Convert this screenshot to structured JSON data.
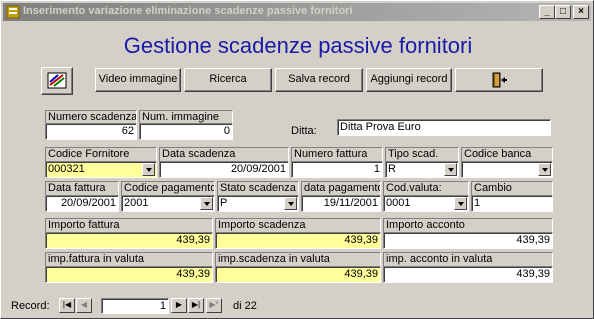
{
  "window": {
    "title": "Inserimento variazione eliminazione scadenze passive fornitori",
    "min_icon": "minimize-icon",
    "max_icon": "maximize-icon",
    "close_icon": "close-icon"
  },
  "header": {
    "title": "Gestione scadenze passive fornitori"
  },
  "toolbar": {
    "chart_icon": "chart-icon",
    "video_label": "Video immagine",
    "ricerca_label": "Ricerca",
    "salva_label": "Salva record",
    "aggiungi_label": "Aggiungi record",
    "exit_icon": "exit-door-icon"
  },
  "form": {
    "numero_scadenza": {
      "label": "Numero scadenza",
      "value": "62"
    },
    "num_immagine": {
      "label": "Num. immagine",
      "value": "0"
    },
    "ditta": {
      "label": "Ditta:",
      "value": "Ditta Prova Euro"
    },
    "codice_fornitore": {
      "label": "Codice Fornitore",
      "value": "000321"
    },
    "data_scadenza": {
      "label": "Data scadenza",
      "value": "20/09/2001"
    },
    "numero_fattura": {
      "label": "Numero fattura",
      "value": "1"
    },
    "tipo_scad": {
      "label": "Tipo scad.",
      "value": "R"
    },
    "codice_banca": {
      "label": "Codice banca",
      "value": ""
    },
    "data_fattura": {
      "label": "Data fattura",
      "value": "20/09/2001"
    },
    "codice_pagamento": {
      "label": "Codice pagamento",
      "value": "2001"
    },
    "stato_scadenza": {
      "label": "Stato scadenza",
      "value": "P"
    },
    "data_pagamento": {
      "label": "data pagamento",
      "value": "19/11/2001"
    },
    "cod_valuta": {
      "label": "Cod.valuta:",
      "value": "0001"
    },
    "cambio": {
      "label": "Cambio",
      "value": "1"
    },
    "importo_fattura": {
      "label": "Importo fattura",
      "value": "439,39"
    },
    "importo_scadenza": {
      "label": "Importo scadenza",
      "value": "439,39"
    },
    "importo_acconto": {
      "label": "Importo acconto",
      "value": "439,39"
    },
    "imp_fattura_valuta": {
      "label": "imp.fattura in valuta",
      "value": "439,39"
    },
    "imp_scadenza_valuta": {
      "label": "imp.scadenza in valuta",
      "value": "439,39"
    },
    "imp_acconto_valuta": {
      "label": "imp. acconto in valuta",
      "value": "439,39"
    }
  },
  "navigation": {
    "record_label": "Record:",
    "current": "1",
    "total_text": "di 22",
    "first": "|◀",
    "prev": "◀",
    "next": "▶",
    "last": "▶|",
    "new": "▶*"
  },
  "colors": {
    "title_text": "#1a1aa8",
    "highlight_field": "#ffff99"
  }
}
